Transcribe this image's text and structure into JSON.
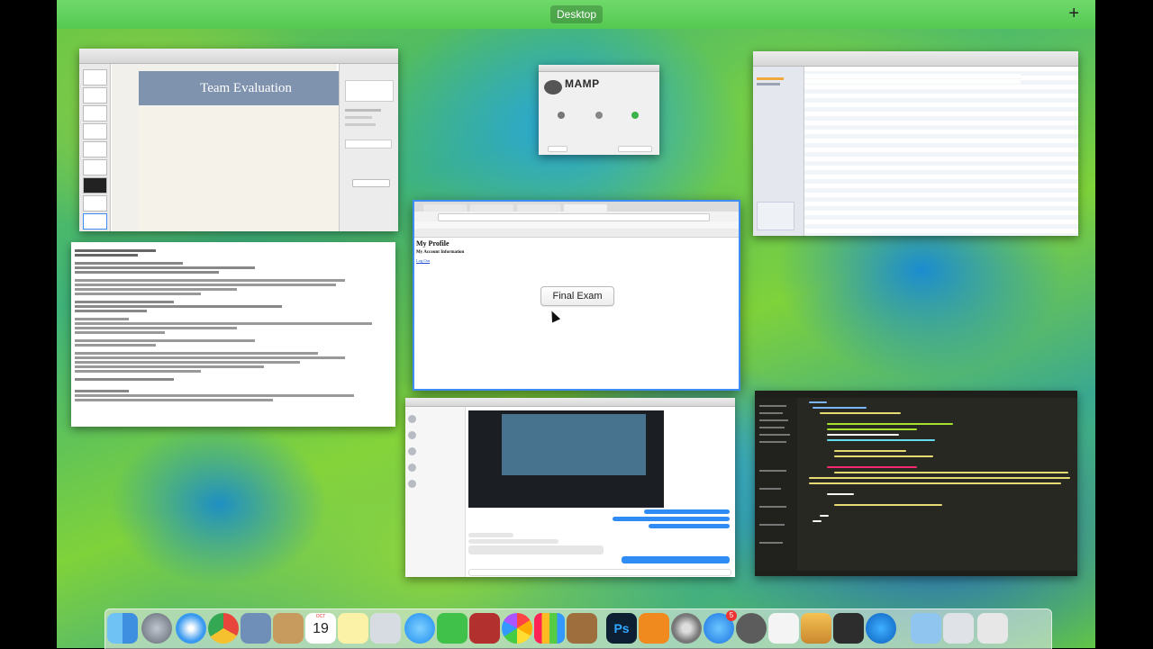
{
  "spaces": {
    "current_space": "Desktop",
    "add_space_symbol": "+"
  },
  "keynote": {
    "slide_title": "Team Evaluation"
  },
  "mamp": {
    "app_name": "MAMP"
  },
  "chrome": {
    "page_title": "My Profile",
    "page_subtitle": "My Account Information",
    "logout_link": "Log Out",
    "button_label": "Final Exam"
  },
  "dock": {
    "calendar_month": "OCT",
    "calendar_day": "19",
    "appstore_badge": "5",
    "photoshop_label": "Ps"
  },
  "colors": {
    "chrome_focus_border": "#3d8df5",
    "spaces_bar": "#5fd25b"
  }
}
